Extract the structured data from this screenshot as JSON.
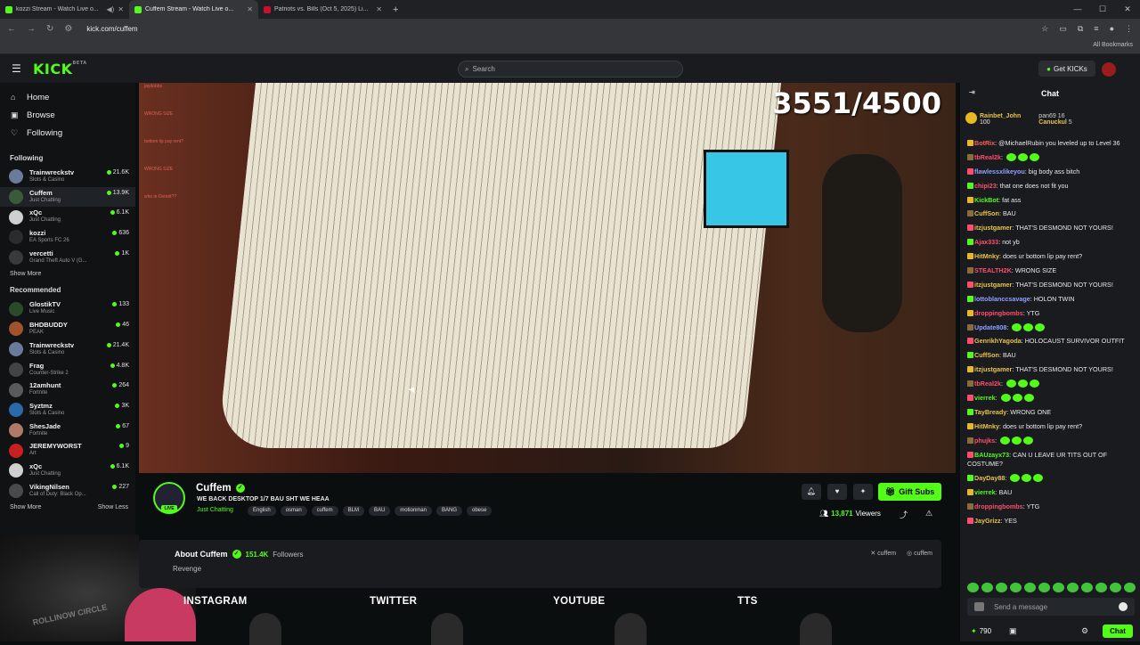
{
  "browser": {
    "tabs": [
      {
        "title": "kozzi Stream - Watch Live o...",
        "fav": "kick"
      },
      {
        "title": "Cuffem Stream - Watch Live o...",
        "fav": "kick"
      },
      {
        "title": "Patriots vs. Bills (Oct 5, 2025) Li...",
        "fav": "nfl"
      }
    ],
    "url": "kick.com/cuffem",
    "all_bookmarks": "All Bookmarks"
  },
  "header": {
    "logo": "KICK",
    "logo_beta": "BETA",
    "search_placeholder": "Search",
    "get_kicks": "Get KICKs"
  },
  "sidebar": {
    "nav": [
      {
        "label": "Home",
        "icon": "home-icon"
      },
      {
        "label": "Browse",
        "icon": "browse-icon"
      },
      {
        "label": "Following",
        "icon": "heart-icon"
      }
    ],
    "following_heading": "Following",
    "following": [
      {
        "name": "Trainwreckstv",
        "cat": "Slots & Casino",
        "viewers": "21.6K",
        "color": "#6a7a9a"
      },
      {
        "name": "Cuffem",
        "cat": "Just Chatting",
        "viewers": "13.9K",
        "color": "#3a5a3a"
      },
      {
        "name": "xQc",
        "cat": "Just Chatting",
        "viewers": "6.1K",
        "color": "#cfcfcf"
      },
      {
        "name": "kozzi",
        "cat": "EA Sports FC 26",
        "viewers": "636",
        "color": "#2c2c2c"
      },
      {
        "name": "vercetti",
        "cat": "Grand Theft Auto V (G...",
        "viewers": "1K",
        "color": "#3a3a3a"
      }
    ],
    "show_more_following": "Show More",
    "recommended_heading": "Recommended",
    "recommended": [
      {
        "name": "GlostikTV",
        "cat": "Live Music",
        "viewers": "133",
        "color": "#2a4a2a"
      },
      {
        "name": "BHDBUDDY",
        "cat": "PEAK",
        "viewers": "46",
        "color": "#a0522d"
      },
      {
        "name": "Trainwreckstv",
        "cat": "Slots & Casino",
        "viewers": "21.4K",
        "color": "#6a7a9a"
      },
      {
        "name": "Frag",
        "cat": "Counter-Strike 2",
        "viewers": "4.8K",
        "color": "#444"
      },
      {
        "name": "12amhunt",
        "cat": "Fortnite",
        "viewers": "264",
        "color": "#5a5a5a"
      },
      {
        "name": "Syztmz",
        "cat": "Slots & Casino",
        "viewers": "3K",
        "color": "#2a6aaa"
      },
      {
        "name": "ShesJade",
        "cat": "Fortnite",
        "viewers": "67",
        "color": "#b07a6a"
      },
      {
        "name": "JEREMYWORST",
        "cat": "Art",
        "viewers": "9",
        "color": "#c82020"
      },
      {
        "name": "xQc",
        "cat": "Just Chatting",
        "viewers": "6.1K",
        "color": "#cfcfcf"
      },
      {
        "name": "VikingNilsen",
        "cat": "Call of Duty: Black Op...",
        "viewers": "227",
        "color": "#4a4a4a"
      }
    ],
    "show_more": "Show More",
    "show_less": "Show Less",
    "webcam_watermark": "ROLLINOW CIRCLE"
  },
  "video": {
    "counter": "3551/4500",
    "overlay_text": [
      "jaydobbs",
      "WRONG SIZE",
      "bottom lip pay rent?",
      "WRONG SIZE",
      "who in Detroit??"
    ]
  },
  "stream": {
    "name": "Cuffem",
    "live": "LIVE",
    "title": "WE BACK DESKTOP 1/7 BAU SHT WE HEAA",
    "category": "Just Chatting",
    "tags": [
      "English",
      "osman",
      "cuffem",
      "BLM",
      "BAU",
      "motionman",
      "BANG",
      "obese"
    ],
    "gift_subs": "Gift Subs",
    "viewers": "13,871",
    "viewers_label": "Viewers"
  },
  "about": {
    "title": "About Cuffem",
    "followers": "151.4K",
    "followers_label": "Followers",
    "social_x": "cuffem",
    "social_ig": "cuffem",
    "revenge": "Revenge"
  },
  "panels": [
    "INSTAGRAM",
    "TWITTER",
    "YOUTUBE",
    "TTS"
  ],
  "chat": {
    "title": "Chat",
    "pinned": [
      {
        "name": "Rainbet_John",
        "amount": "100"
      },
      {
        "name": "pan69",
        "amount": "16"
      },
      {
        "name": "Canuckul",
        "amount": "5"
      }
    ],
    "messages": [
      {
        "user": "BotRix",
        "color": "#ff5b5b",
        "text": "@MichaelRubin you leveled up to Level 36"
      },
      {
        "user": "tbReal2k",
        "color": "#ff4d6d",
        "text": ""
      },
      {
        "user": "flawlessxlikeyou",
        "color": "#8ea0ff",
        "text": "big body ass bitch"
      },
      {
        "user": "chipi23",
        "color": "#ff4d6d",
        "text": "that one does not fit you"
      },
      {
        "user": "KickBot",
        "color": "#53fc18",
        "text": "fat ass"
      },
      {
        "user": "CuffSon",
        "color": "#e8c349",
        "text": "BAU"
      },
      {
        "user": "itzjustgamer",
        "color": "#e8c349",
        "text": "THAT'S DESMOND NOT YOURS!"
      },
      {
        "user": "Ajax333",
        "color": "#ff4d6d",
        "text": "not yb"
      },
      {
        "user": "HitMnky",
        "color": "#e8c349",
        "text": "does ur bottom lip pay rent?"
      },
      {
        "user": "STEALTH2K",
        "color": "#ff4d6d",
        "text": "WRONG SIZE"
      },
      {
        "user": "itzjustgamer",
        "color": "#e8c349",
        "text": "THAT'S DESMOND NOT YOURS!"
      },
      {
        "user": "lottoblanccsavage",
        "color": "#8ea0ff",
        "text": "HOLON TWIN"
      },
      {
        "user": "droppingbombs",
        "color": "#ff4d6d",
        "text": "YTG"
      },
      {
        "user": "Update808",
        "color": "#8ea0ff",
        "text": ""
      },
      {
        "user": "GenrikhYagoda",
        "color": "#e8c349",
        "text": "HOLOCAUST SURVIVOR OUTFIT"
      },
      {
        "user": "CuffSon",
        "color": "#e8c349",
        "text": "BAU"
      },
      {
        "user": "itzjustgamer",
        "color": "#e8c349",
        "text": "THAT'S DESMOND NOT YOURS!"
      },
      {
        "user": "tbReal2k",
        "color": "#ff4d6d",
        "text": ""
      },
      {
        "user": "vierrek",
        "color": "#53fc18",
        "text": ""
      },
      {
        "user": "TayBready",
        "color": "#e8c349",
        "text": "WRONG ONE"
      },
      {
        "user": "HitMnky",
        "color": "#e8c349",
        "text": "does ur bottom lip pay rent?"
      },
      {
        "user": "phujks",
        "color": "#ff4d6d",
        "text": ""
      },
      {
        "user": "BAUzayx73",
        "color": "#53fc18",
        "text": "CAN U LEAVE UR TITS OUT OF COSTUME?"
      },
      {
        "user": "DayDay88",
        "color": "#e8c349",
        "text": ""
      },
      {
        "user": "vierrek",
        "color": "#53fc18",
        "text": "BAU"
      },
      {
        "user": "droppingbombs",
        "color": "#ff4d6d",
        "text": "YTG"
      },
      {
        "user": "JayGrizz",
        "color": "#e8c349",
        "text": "YES"
      }
    ],
    "input_placeholder": "Send a message",
    "points": "790",
    "send": "Chat"
  }
}
